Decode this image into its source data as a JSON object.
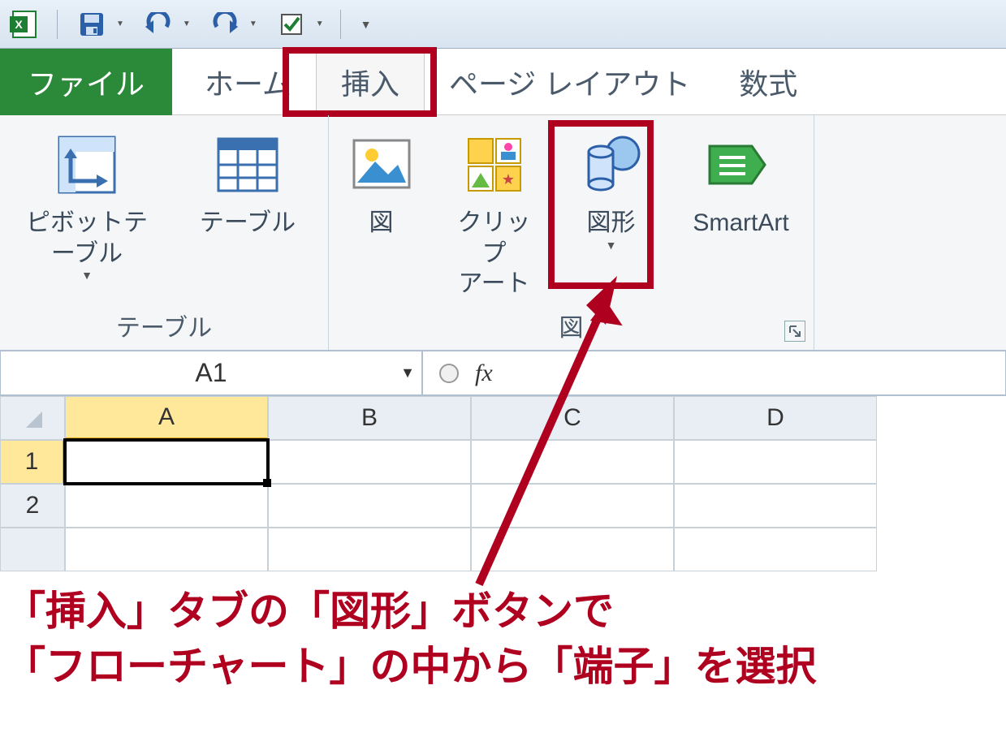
{
  "qat": {},
  "tabs": {
    "file": "ファイル",
    "home": "ホーム",
    "insert": "挿入",
    "pagelayout": "ページ レイアウト",
    "formulas": "数式"
  },
  "ribbon": {
    "groups": {
      "tables": {
        "label": "テーブル",
        "pivot": "ピボットテーブル",
        "table": "テーブル"
      },
      "illustrations": {
        "label": "図",
        "picture": "図",
        "clipart": "クリップ\nアート",
        "shapes": "図形",
        "smartart": "SmartArt"
      }
    }
  },
  "formula_bar": {
    "namebox": "A1",
    "fx": "fx"
  },
  "grid": {
    "cols": [
      "A",
      "B",
      "C",
      "D"
    ],
    "rows": [
      "1",
      "2"
    ],
    "selected_cell": "A1"
  },
  "annotation": {
    "line1": "「挿入」タブの「図形」ボタンで",
    "line2": "「フローチャート」の中から「端子」を選択"
  }
}
